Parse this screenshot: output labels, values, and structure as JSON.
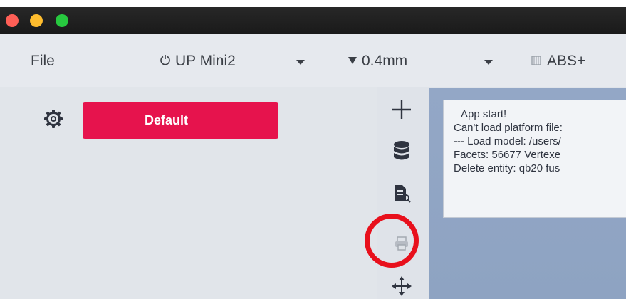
{
  "window": {
    "title_bar": {
      "buttons": [
        "close",
        "minimize",
        "zoom"
      ]
    }
  },
  "menubar": {
    "file_label": "File",
    "printer": {
      "icon": "power-icon",
      "label": "UP Mini2"
    },
    "nozzle": {
      "icon": "nozzle-triangle-icon",
      "label": "0.4mm"
    },
    "material": {
      "icon": "material-spool-icon",
      "label": "ABS+"
    }
  },
  "left_panel": {
    "profile_button_label": "Default"
  },
  "tools": [
    {
      "name": "add-model",
      "icon": "plus-icon"
    },
    {
      "name": "database",
      "icon": "database-icon"
    },
    {
      "name": "document",
      "icon": "document-icon"
    },
    {
      "name": "print",
      "icon": "printer-icon"
    },
    {
      "name": "move",
      "icon": "move-icon"
    }
  ],
  "log": {
    "lines": [
      "App start!",
      "Can't load platform file:",
      "--- Load model: /users/",
      "Facets: 56677  Vertexe",
      "Delete entity: qb20 fus"
    ]
  },
  "colors": {
    "accent": "#e6134d",
    "highlight_ring": "#e8101c",
    "workspace": "#93a7c6"
  }
}
